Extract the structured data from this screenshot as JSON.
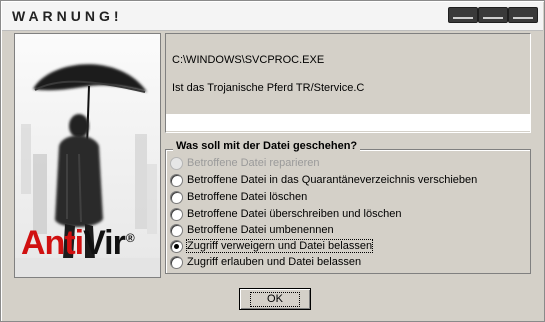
{
  "window": {
    "title": "WARNUNG!"
  },
  "brand": {
    "name_red": "Anti",
    "name_black": "Vir",
    "mark": "®"
  },
  "info": {
    "path": "C:\\WINDOWS\\SVCPROC.EXE",
    "message": "Ist das Trojanische Pferd TR/Stervice.C"
  },
  "group": {
    "legend": "Was soll mit der Datei geschehen?",
    "options": [
      {
        "label": "Betroffene Datei reparieren",
        "disabled": true,
        "checked": false
      },
      {
        "label": "Betroffene Datei in das Quarantäneverzeichnis verschieben",
        "disabled": false,
        "checked": false
      },
      {
        "label": "Betroffene Datei löschen",
        "disabled": false,
        "checked": false
      },
      {
        "label": "Betroffene Datei überschreiben und löschen",
        "disabled": false,
        "checked": false
      },
      {
        "label": "Betroffene Datei umbenennen",
        "disabled": false,
        "checked": false
      },
      {
        "label": "Zugriff verweigern und Datei belassen",
        "disabled": false,
        "checked": true
      },
      {
        "label": "Zugriff erlauben und Datei belassen",
        "disabled": false,
        "checked": false
      }
    ]
  },
  "buttons": {
    "ok": "OK"
  },
  "icons": [
    "minimize-icon",
    "maximize-icon",
    "close-icon",
    "umbrella-figure-image"
  ],
  "colors": {
    "accent": "#d01010",
    "window_bg": "#d4d0c8"
  }
}
